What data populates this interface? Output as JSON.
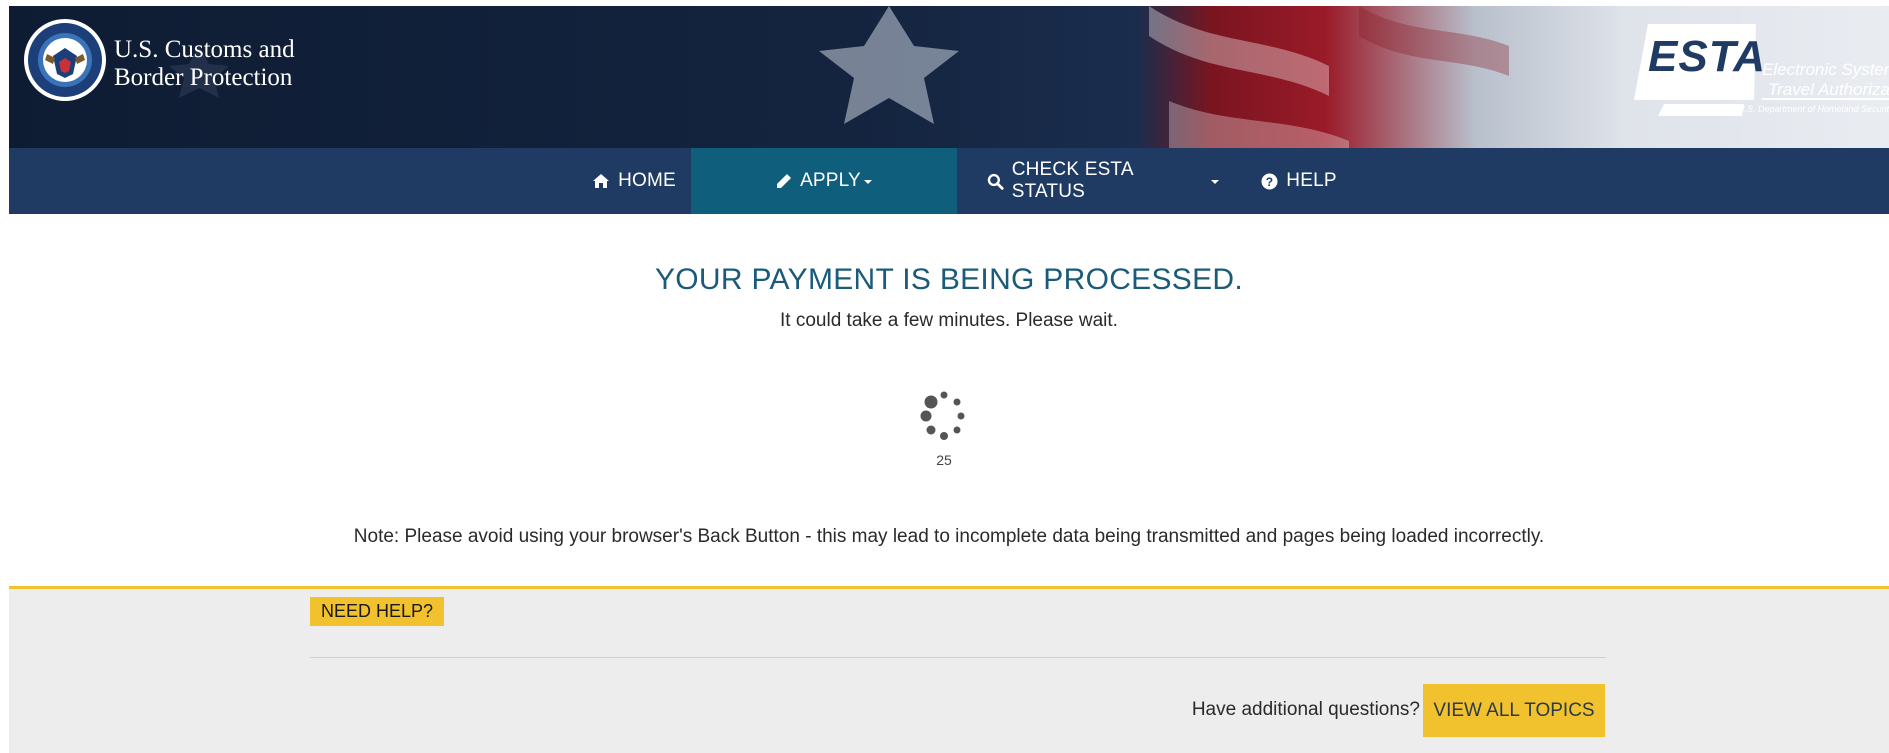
{
  "header": {
    "agency_line1": "U.S. Customs and",
    "agency_line2": "Border Protection",
    "seal_text": "DEPARTMENT OF HOMELAND SECURITY",
    "esta_logo_text": "ESTA",
    "esta_tagline_line1": "Electronic System for",
    "esta_tagline_line2": "Travel Authorization",
    "esta_dept": "U.S. Department of Homeland Security"
  },
  "nav": {
    "items": [
      {
        "label": "HOME",
        "icon": "home-icon",
        "dropdown": false,
        "active": false
      },
      {
        "label": "APPLY",
        "icon": "pencil-icon",
        "dropdown": true,
        "active": true
      },
      {
        "label": "CHECK ESTA STATUS",
        "icon": "search-icon",
        "dropdown": true,
        "active": false
      },
      {
        "label": "HELP",
        "icon": "question-circle-icon",
        "dropdown": false,
        "active": false
      }
    ]
  },
  "main": {
    "title": "YOUR PAYMENT IS BEING PROCESSED.",
    "subtitle": "It could take a few minutes. Please wait.",
    "counter": "25",
    "note": "Note: Please avoid using your browser's Back Button - this may lead to incomplete data being transmitted and pages being loaded incorrectly."
  },
  "help": {
    "badge": "NEED HELP?",
    "question": "Have additional questions?",
    "button_label": "VIEW ALL TOPICS"
  },
  "colors": {
    "nav_bg": "#1f3b63",
    "nav_active": "#0f5f7c",
    "title": "#1a5b7a",
    "accent_yellow": "#f2c12e",
    "help_bg": "#ededed"
  }
}
